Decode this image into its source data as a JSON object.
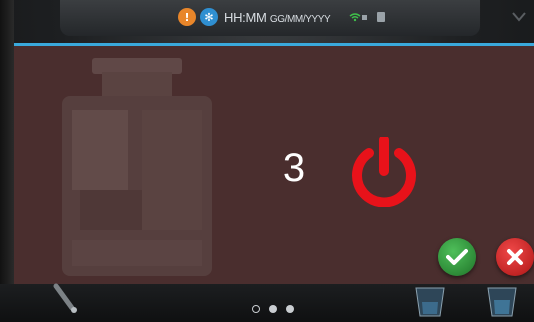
{
  "status_bar": {
    "warning_icon": "warning-icon",
    "descale_icon": "snowflake-icon",
    "time_format": "HH:MM",
    "date_format": "GG/MM/YYYY",
    "wifi_icon": "wifi-icon",
    "device_icon": "device-icon"
  },
  "dialog": {
    "countdown": "3",
    "power_icon": "power-icon",
    "confirm_icon": "checkmark-icon",
    "cancel_icon": "close-icon",
    "accent_color": "#3aa9dc",
    "power_color": "#e8121a"
  },
  "pager": {
    "page_count": 3,
    "current_page": 1
  }
}
